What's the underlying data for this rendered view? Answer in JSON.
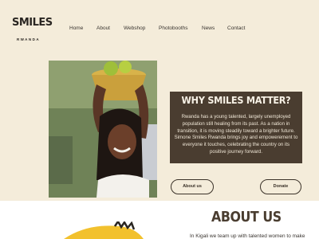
{
  "header": {
    "logo_text": "SMILES",
    "logo_sub": "RWANDA",
    "nav": [
      "Home",
      "About",
      "Webshop",
      "Photobooths",
      "News",
      "Contact"
    ]
  },
  "hero": {
    "heading": "WHY SMILES MATTER?",
    "body": "Rwanda has a young talented, largely unemployed population still healing from its past. As a nation in transition, it is moving steadily toward a brighter future. Simone Smiles Rwanda brings joy and empowerement to everyone it touches, celebrating the country on its positive journey forward.",
    "buttons": {
      "about": "About us",
      "donate": "Donate"
    }
  },
  "about": {
    "title": "ABOUT US",
    "intro": "In Kigali we team up with talented women to make"
  },
  "colors": {
    "background": "#f4ecda",
    "panel": "#4a3d30",
    "accent_yellow": "#f2c12e"
  }
}
